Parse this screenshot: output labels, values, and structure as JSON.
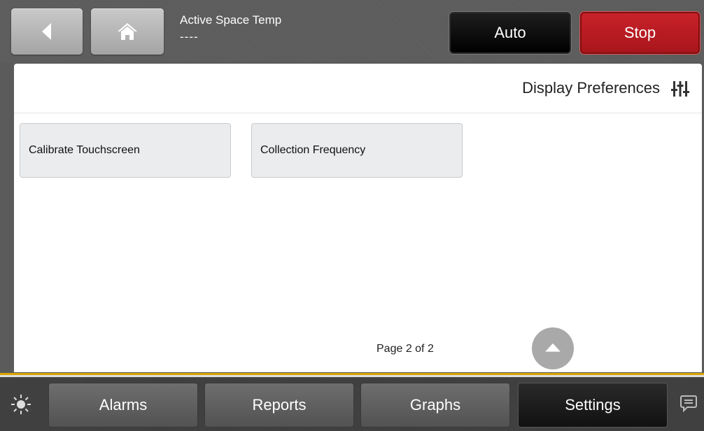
{
  "header": {
    "title": "Active Space Temp",
    "value": "----",
    "auto_label": "Auto",
    "stop_label": "Stop",
    "icons": {
      "back": "back-arrow-icon",
      "home": "home-icon"
    }
  },
  "panel": {
    "title": "Display Preferences",
    "title_icon": "sliders-icon",
    "tiles": [
      "Calibrate Touchscreen",
      "Collection Frequency"
    ],
    "page_indicator": "Page 2 of 2",
    "scroll_icon": "chevron-up-icon"
  },
  "footer": {
    "tabs": [
      "Alarms",
      "Reports",
      "Graphs",
      "Settings"
    ],
    "active_tab": "Settings",
    "left_icon": "brightness-icon",
    "right_icon": "chat-icon"
  },
  "colors": {
    "stop": "#c8222a",
    "accent_line": "#d9a400",
    "active_tab": "#1a1a1a"
  }
}
